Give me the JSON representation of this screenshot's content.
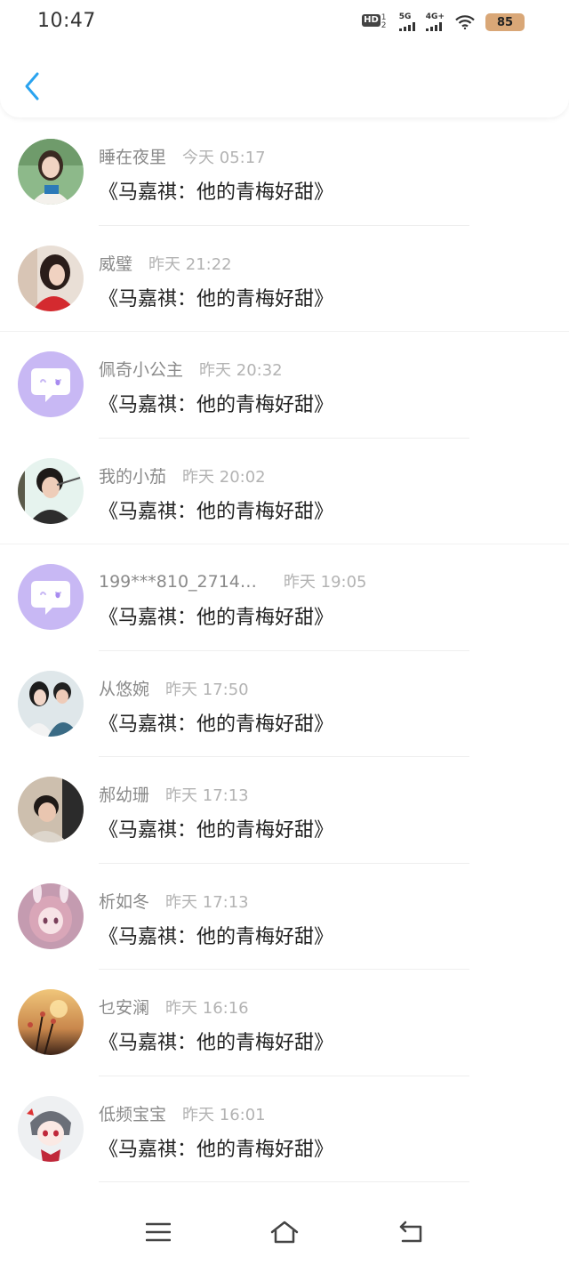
{
  "status_bar": {
    "time": "10:47",
    "hd_label": "HD",
    "hd_sub": "1 2",
    "network_1": "5G",
    "network_2": "4G+",
    "battery": "85"
  },
  "header": {
    "back_icon": "chevron-left-icon",
    "accent_color": "#2aa3ef"
  },
  "comments": [
    {
      "name": "睡在夜里",
      "time": "今天 05:17",
      "message": "《马嘉祺：他的青梅好甜》",
      "avatar": "photo-woman-green"
    },
    {
      "name": "威璧",
      "time": "昨天 21:22",
      "message": "《马嘉祺：他的青梅好甜》",
      "avatar": "photo-woman-red"
    },
    {
      "name": "佩奇小公主",
      "time": "昨天 20:32",
      "message": "《马嘉祺：他的青梅好甜》",
      "avatar": "default-chat-icon"
    },
    {
      "name": "我的小茄",
      "time": "昨天 20:02",
      "message": "《马嘉祺：他的青梅好甜》",
      "avatar": "photo-young-man"
    },
    {
      "name": "199***810_2714…",
      "time": "昨天 19:05",
      "message": "《马嘉祺：他的青梅好甜》",
      "avatar": "default-chat-icon"
    },
    {
      "name": "从悠婉",
      "time": "昨天 17:50",
      "message": "《马嘉祺：他的青梅好甜》",
      "avatar": "photo-couple"
    },
    {
      "name": "郝幼珊",
      "time": "昨天 17:13",
      "message": "《马嘉祺：他的青梅好甜》",
      "avatar": "photo-boy"
    },
    {
      "name": "析如冬",
      "time": "昨天 17:13",
      "message": "《马嘉祺：他的青梅好甜》",
      "avatar": "anime-girl-pink"
    },
    {
      "name": "乜安澜",
      "time": "昨天 16:16",
      "message": "《马嘉祺：他的青梅好甜》",
      "avatar": "photo-sunset-flowers"
    },
    {
      "name": "低频宝宝",
      "time": "昨天 16:01",
      "message": "《马嘉祺：他的青梅好甜》",
      "avatar": "anime-chibi-red"
    }
  ],
  "navbar": {
    "menu_icon": "menu-icon",
    "home_icon": "home-icon",
    "back_icon": "back-arrow-icon"
  }
}
